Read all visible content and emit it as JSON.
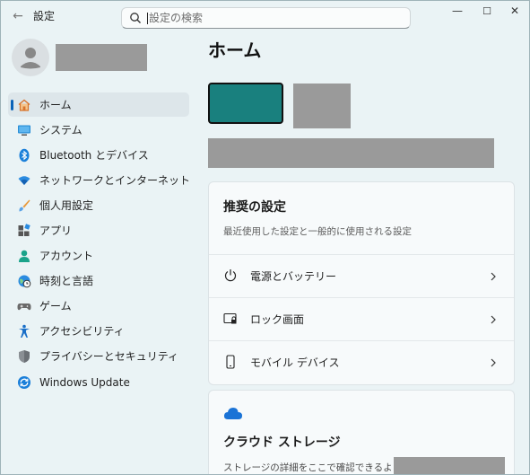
{
  "titlebar": {
    "back_glyph": "←",
    "title": "設定",
    "search_placeholder": "設定の検索",
    "min_glyph": "—",
    "max_glyph": "☐",
    "close_glyph": "✕"
  },
  "sidebar": {
    "items": [
      {
        "label": "ホーム",
        "icon": "home-icon",
        "selected": true
      },
      {
        "label": "システム",
        "icon": "monitor-icon"
      },
      {
        "label": "Bluetooth とデバイス",
        "icon": "bluetooth-icon"
      },
      {
        "label": "ネットワークとインターネット",
        "icon": "wifi-icon"
      },
      {
        "label": "個人用設定",
        "icon": "brush-icon"
      },
      {
        "label": "アプリ",
        "icon": "apps-icon"
      },
      {
        "label": "アカウント",
        "icon": "account-icon"
      },
      {
        "label": "時刻と言語",
        "icon": "globe-clock-icon"
      },
      {
        "label": "ゲーム",
        "icon": "gamepad-icon"
      },
      {
        "label": "アクセシビリティ",
        "icon": "accessibility-icon"
      },
      {
        "label": "プライバシーとセキュリティ",
        "icon": "shield-icon"
      },
      {
        "label": "Windows Update",
        "icon": "sync-icon"
      }
    ]
  },
  "main": {
    "title": "ホーム",
    "recommended": {
      "title": "推奨の設定",
      "subtitle": "最近使用した設定と一般的に使用される設定",
      "rows": [
        {
          "label": "電源とバッテリー",
          "icon": "power-icon"
        },
        {
          "label": "ロック画面",
          "icon": "lock-screen-icon"
        },
        {
          "label": "モバイル デバイス",
          "icon": "phone-icon"
        }
      ]
    },
    "cloud": {
      "title": "クラウド ストレージ",
      "text": "ストレージの詳細をここで確認できるように",
      "icon": "cloud-icon"
    }
  },
  "colors": {
    "accent": "#0b63b8",
    "tile": "#19807e",
    "background": "#eaf3f5",
    "selected_nav": "#dde6ea"
  }
}
